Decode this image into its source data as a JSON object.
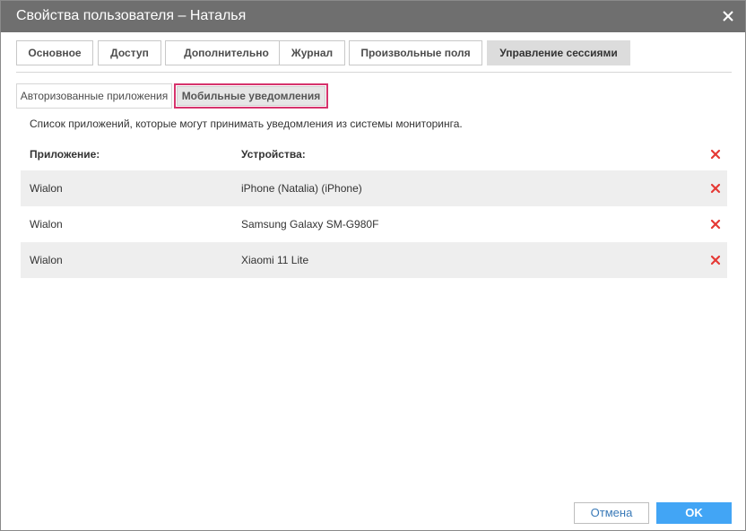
{
  "window": {
    "title": "Свойства пользователя – Наталья"
  },
  "tabs": [
    {
      "label": "Основное"
    },
    {
      "label": "Доступ"
    },
    {
      "label": "Дополнительно"
    },
    {
      "label": "Журнал"
    },
    {
      "label": "Произвольные поля"
    },
    {
      "label": "Управление сессиями",
      "active": true
    }
  ],
  "subtabs": [
    {
      "label": "Авторизованные приложения"
    },
    {
      "label": "Мобильные уведомления",
      "active": true
    }
  ],
  "description": "Список приложений, которые могут принимать уведомления из системы мониторинга.",
  "table": {
    "headers": {
      "app": "Приложение:",
      "devices": "Устройства:"
    },
    "rows": [
      {
        "app": "Wialon",
        "device": "iPhone (Natalia) (iPhone)"
      },
      {
        "app": "Wialon",
        "device": "Samsung Galaxy SM-G980F"
      },
      {
        "app": "Wialon",
        "device": "Xiaomi 11 Lite"
      }
    ]
  },
  "footer": {
    "cancel_label": "Отмена",
    "ok_label": "OK"
  },
  "colors": {
    "titlebar": "#6f6f6f",
    "delete_icon": "#e53935",
    "ok_button": "#42a5f5",
    "active_subtab_outline": "#d6336c"
  },
  "icons": {
    "close": "close-icon",
    "delete": "delete-x-icon"
  }
}
